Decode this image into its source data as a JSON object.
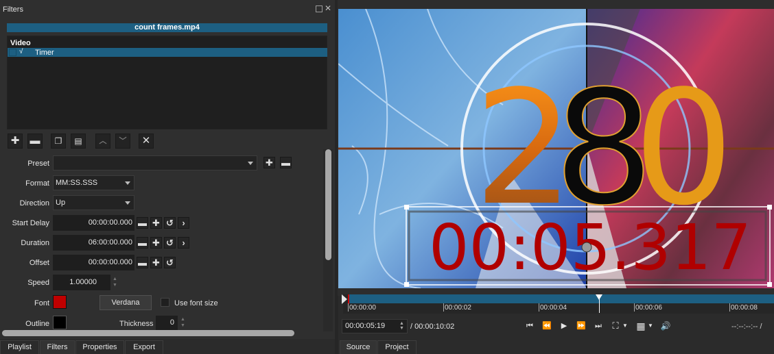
{
  "panel": {
    "title": "Filters"
  },
  "clip": {
    "name": "count frames.mp4"
  },
  "filter_list": {
    "header": "Video",
    "items": [
      {
        "label": "Timer",
        "checked": true,
        "check_glyph": "√"
      }
    ]
  },
  "toolbar": {
    "icons": [
      "add-icon",
      "remove-icon",
      "copy-icon",
      "paste-icon",
      "move-up-icon",
      "move-down-icon",
      "deselect-icon"
    ]
  },
  "props": {
    "preset": {
      "label": "Preset",
      "value": ""
    },
    "format": {
      "label": "Format",
      "value": "MM:SS.SSS"
    },
    "direction": {
      "label": "Direction",
      "value": "Up"
    },
    "start_delay": {
      "label": "Start Delay",
      "value": "00:00:00.000"
    },
    "duration": {
      "label": "Duration",
      "value": "06:00:00.000"
    },
    "offset": {
      "label": "Offset",
      "value": "00:00:00.000"
    },
    "speed": {
      "label": "Speed",
      "value": "1.00000"
    },
    "font": {
      "label": "Font",
      "button": "Verdana",
      "color": "#c00000",
      "use_font_size": "Use font size"
    },
    "outline": {
      "label": "Outline",
      "color": "#000000",
      "thickness_label": "Thickness",
      "thickness": "0"
    }
  },
  "left_tabs": [
    "Playlist",
    "Filters",
    "Properties",
    "Export"
  ],
  "right_tabs": [
    "Source",
    "Project"
  ],
  "video": {
    "countdown_digits": "280",
    "overlay_text": "00:05.317",
    "overlay_color": "#b00000"
  },
  "timeline": {
    "ticks": [
      "00:00:00",
      "00:00:02",
      "00:00:04",
      "00:00:06",
      "00:00:08"
    ],
    "playhead_fraction": 0.59
  },
  "transport": {
    "position": "00:00:05:19",
    "duration": "/ 00:00:10:02",
    "out_timecode": "--:--:--:-- /",
    "icons": [
      "skip-start-icon",
      "rewind-icon",
      "play-icon",
      "fast-forward-icon",
      "skip-end-icon",
      "zoom-icon",
      "grid-icon",
      "volume-icon"
    ]
  }
}
